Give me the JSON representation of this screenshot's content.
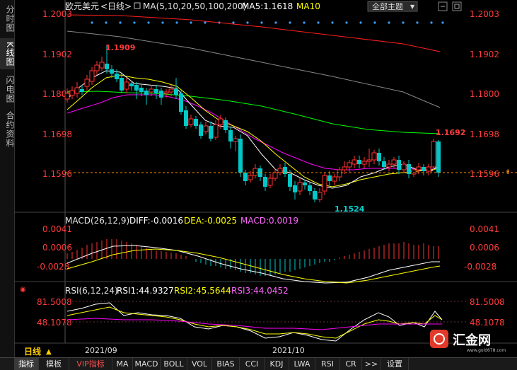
{
  "left_tabs": [
    "分时图",
    "K线图",
    "闪电图",
    "合约资料"
  ],
  "header": {
    "symbol": "欧元美元",
    "period": "<日线>",
    "ma_label": "MA(5,10,20,50,100,200)",
    "ma5_label": "MA5:1.1618",
    "ma10_label": "MA10",
    "theme_button": "全部主题",
    "theme_arrow": "▼"
  },
  "price_axis_left": [
    "1.2003",
    "1.1902",
    "1.1800",
    "1.1698",
    "1.1596"
  ],
  "price_axis_right": [
    "1.2003",
    "1.1902",
    "1.1800",
    "1.1698",
    "1.1596"
  ],
  "annotations": {
    "high": "1.1909",
    "low": "1.1524",
    "last": "1.1692"
  },
  "macd": {
    "title": "MACD(26,12,9)",
    "diff": "DIFF:-0.0016",
    "dea": "DEA:-0.0025",
    "macd": "MACD:0.0019",
    "axis": [
      "0.0041",
      "0.0006",
      "-0.0028"
    ]
  },
  "rsi": {
    "title": "RSI(6,12,24)",
    "rsi1": "RSI1:44.9327",
    "rsi2": "RSI2:45.5644",
    "rsi3": "RSI3:44.0452",
    "axis": [
      "81.5008",
      "48.1078"
    ]
  },
  "time_axis": {
    "period_label": "日线",
    "arrow": "▲",
    "months": [
      "2021/09",
      "2021/10"
    ]
  },
  "brand": {
    "name": "汇金网",
    "url": "www.gold678.com"
  },
  "bottom_tabs": [
    "指标",
    "模板",
    "VIP指标",
    "MA",
    "MACD",
    "BOLL",
    "VOL",
    "BIAS",
    "CCI",
    "KDJ",
    "LWA",
    "RSI",
    "CR",
    ">>",
    "设置"
  ],
  "colors": {
    "up": "#ff3232",
    "down": "#00c8c8",
    "ma5": "#ffffff",
    "ma10": "#ffff00",
    "ma20": "#ff00ff",
    "ma50": "#00ff00",
    "ma100": "#888888",
    "ma200": "#ff2020"
  }
}
